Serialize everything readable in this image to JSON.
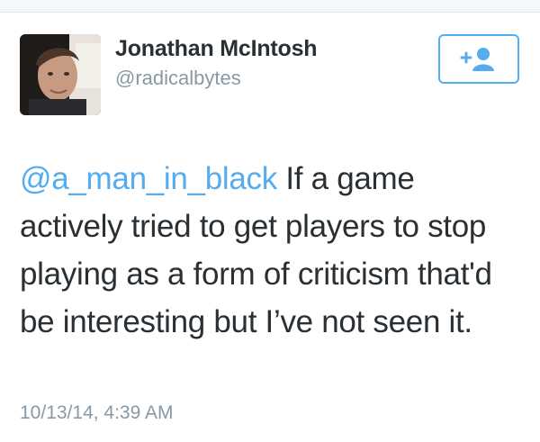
{
  "user": {
    "display_name": "Jonathan McIntosh",
    "handle": "@radicalbytes"
  },
  "follow_button": {
    "icon": "follow-user-icon",
    "accent_color": "#55acee"
  },
  "tweet": {
    "mention": "@a_man_in_black",
    "body": " If a game actively tried to get players to stop playing as a form of criticism that'd be interesting but I’ve not seen it.",
    "timestamp": "10/13/14, 4:39 AM"
  },
  "colors": {
    "text": "#292f33",
    "muted": "#8899a6",
    "link": "#55acee"
  }
}
